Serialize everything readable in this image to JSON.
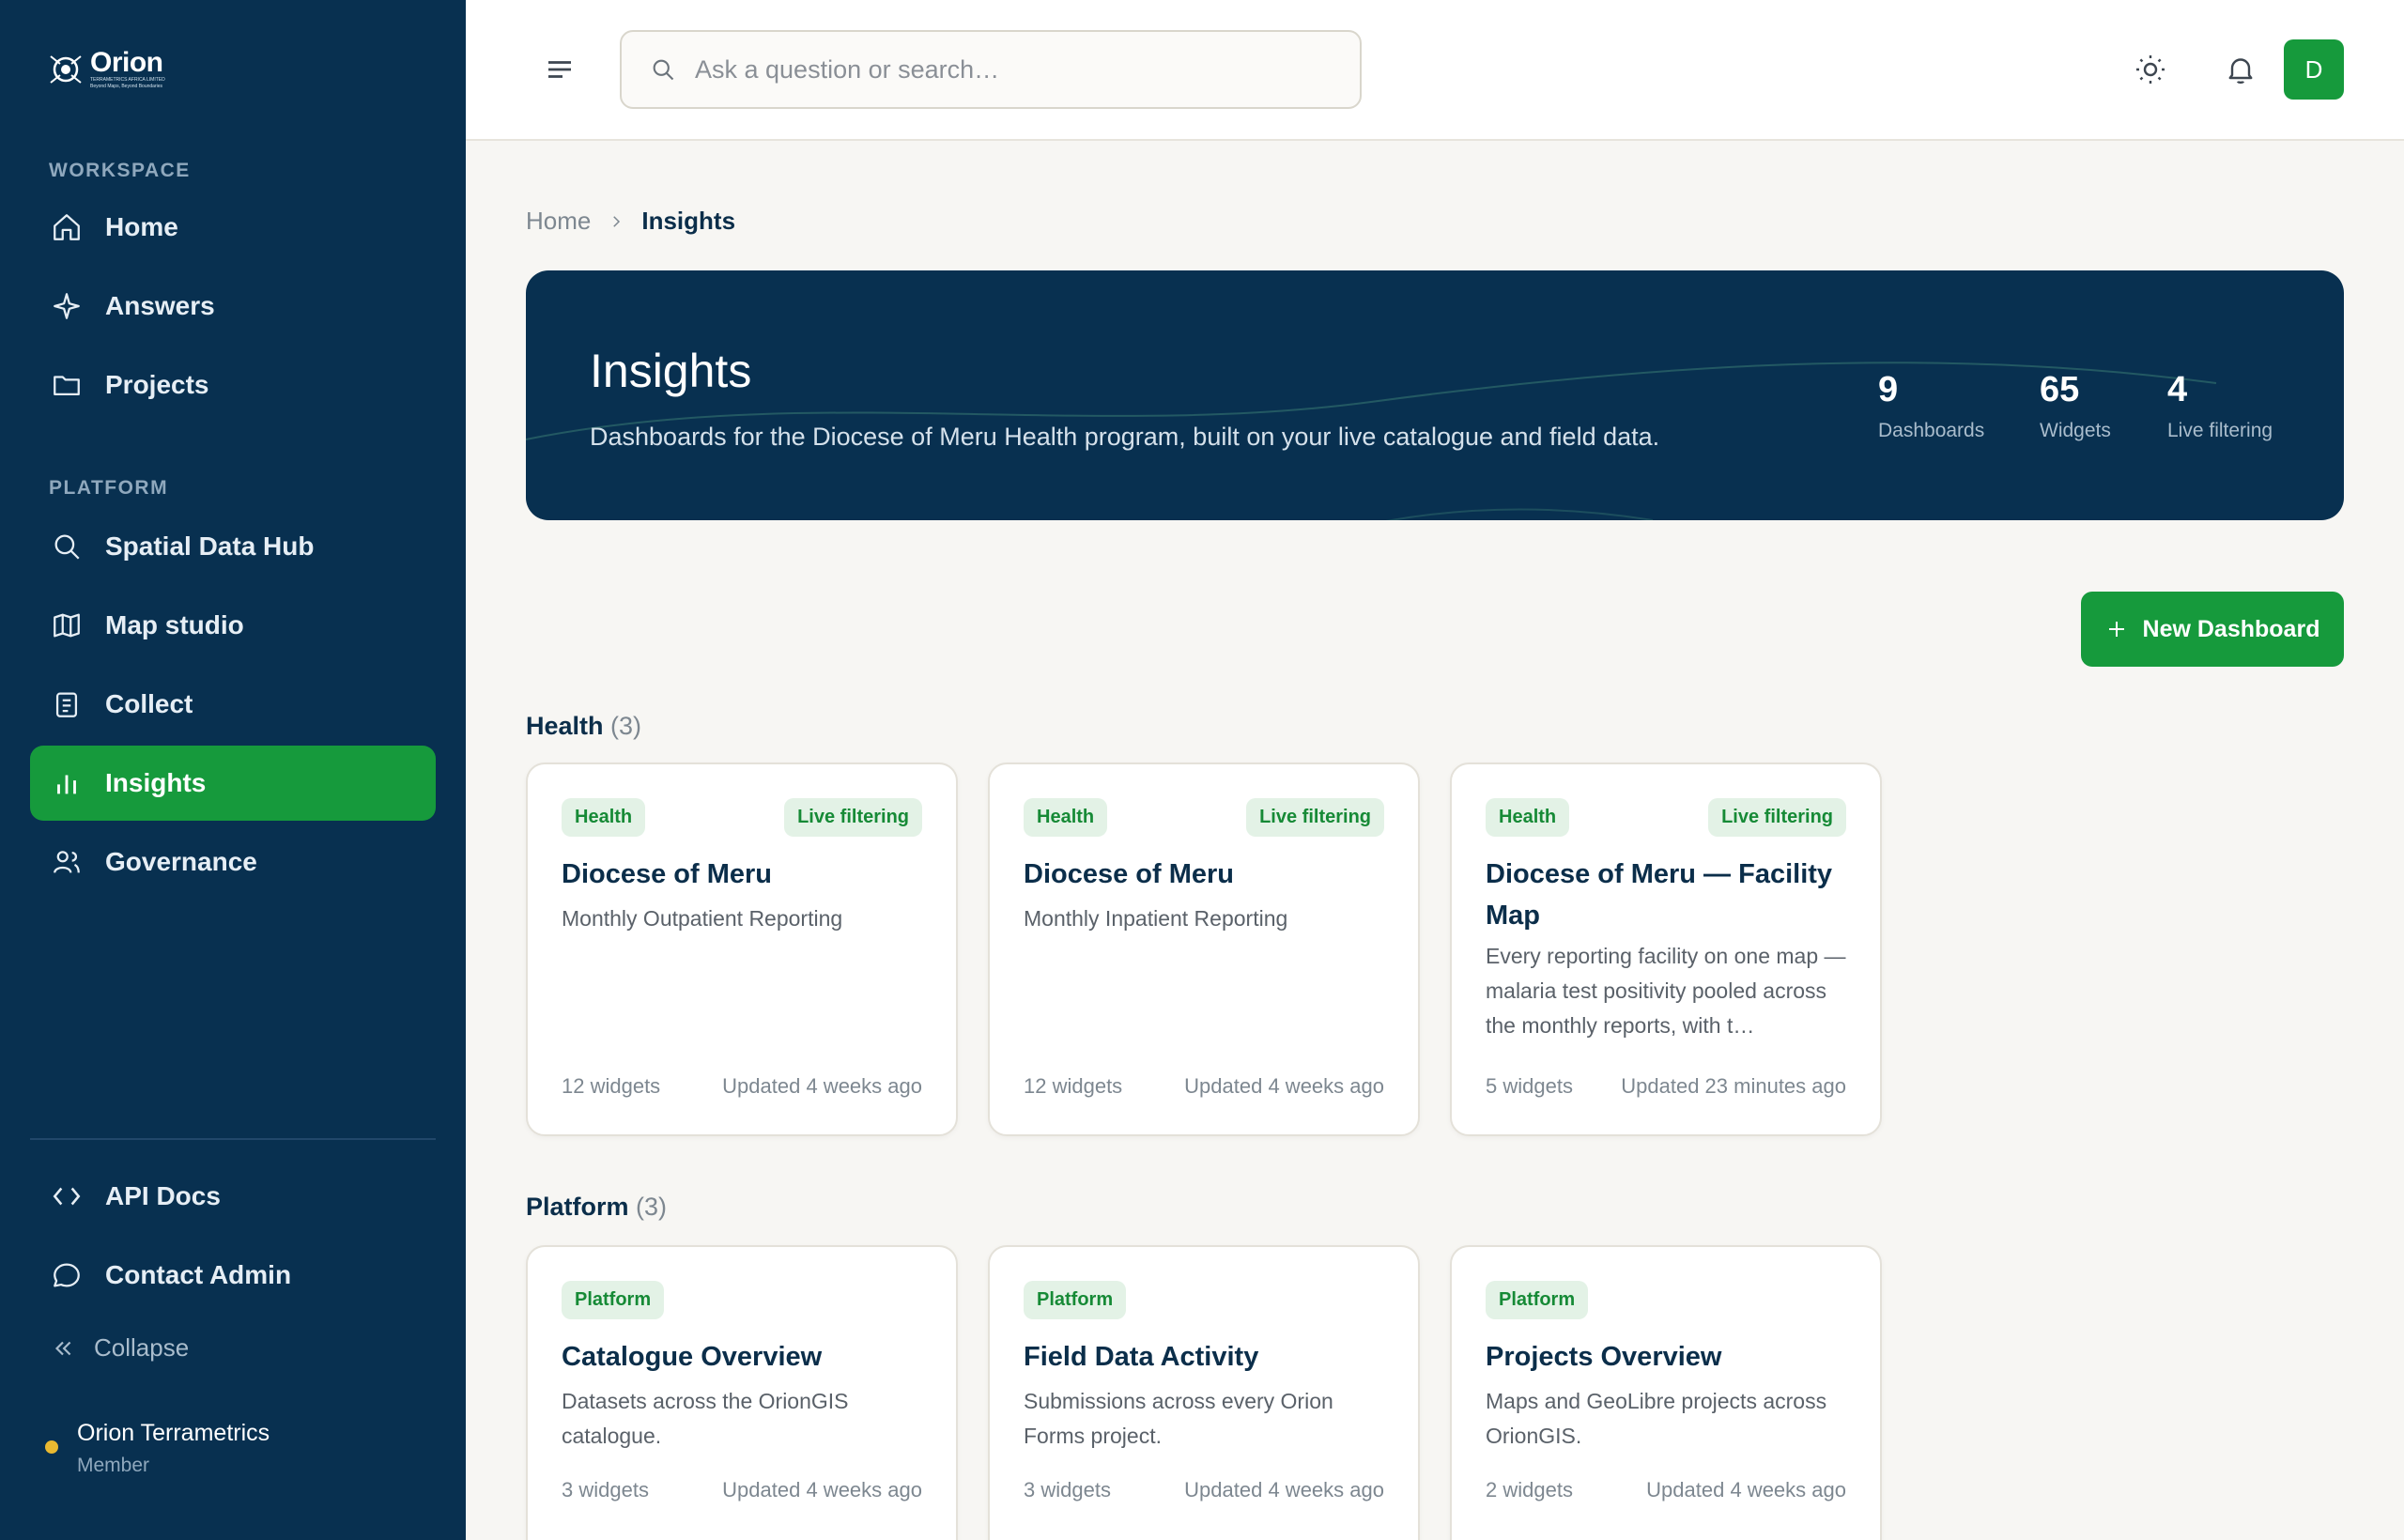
{
  "brand": {
    "name": "Orion",
    "tagline_1": "TERRAMETRICS AFRICA LIMITED",
    "tagline_2": "Beyond Maps, Beyond Boundaries"
  },
  "sidebar": {
    "workspace_label": "WORKSPACE",
    "platform_label": "PLATFORM",
    "items": [
      {
        "label": "Home",
        "icon": "home-icon"
      },
      {
        "label": "Answers",
        "icon": "sparkle-icon"
      },
      {
        "label": "Projects",
        "icon": "folder-icon"
      },
      {
        "label": "Spatial Data Hub",
        "icon": "search-icon"
      },
      {
        "label": "Map studio",
        "icon": "map-icon"
      },
      {
        "label": "Collect",
        "icon": "clipboard-icon"
      },
      {
        "label": "Insights",
        "icon": "bar-chart-icon",
        "active": true
      },
      {
        "label": "Governance",
        "icon": "users-icon"
      },
      {
        "label": "API Docs",
        "icon": "code-icon"
      },
      {
        "label": "Contact Admin",
        "icon": "chat-icon"
      }
    ],
    "collapse_label": "Collapse",
    "user": {
      "name": "Orion Terrametrics",
      "role": "Member",
      "status_color": "#e9b931"
    }
  },
  "header": {
    "search_placeholder": "Ask a question or search…",
    "avatar_initial": "D"
  },
  "breadcrumb": {
    "home": "Home",
    "current": "Insights"
  },
  "hero": {
    "title": "Insights",
    "subtitle": "Dashboards for the Diocese of Meru Health program, built on your live catalogue and field data.",
    "stats": [
      {
        "value": "9",
        "label": "Dashboards"
      },
      {
        "value": "65",
        "label": "Widgets"
      },
      {
        "value": "4",
        "label": "Live filtering"
      }
    ]
  },
  "new_dashboard_label": "New Dashboard",
  "groups": [
    {
      "title": "Health",
      "count": "(3)",
      "cards": [
        {
          "tag": "Health",
          "live": "Live filtering",
          "title": "Diocese of Meru",
          "desc": "Monthly Outpatient Reporting",
          "widgets": "12 widgets",
          "updated": "Updated 4 weeks ago"
        },
        {
          "tag": "Health",
          "live": "Live filtering",
          "title": "Diocese of Meru",
          "desc": "Monthly Inpatient Reporting",
          "widgets": "12 widgets",
          "updated": "Updated 4 weeks ago"
        },
        {
          "tag": "Health",
          "live": "Live filtering",
          "title": "Diocese of Meru — Facility Map",
          "desc": "Every reporting facility on one map — malaria test positivity pooled across the monthly reports, with t…",
          "widgets": "5 widgets",
          "updated": "Updated 23 minutes ago"
        }
      ]
    },
    {
      "title": "Platform",
      "count": "(3)",
      "cards": [
        {
          "tag": "Platform",
          "title": "Catalogue Overview",
          "desc": "Datasets across the OrionGIS catalogue.",
          "widgets": "3 widgets",
          "updated": "Updated 4 weeks ago"
        },
        {
          "tag": "Platform",
          "title": "Field Data Activity",
          "desc": "Submissions across every Orion Forms project.",
          "widgets": "3 widgets",
          "updated": "Updated 4 weeks ago"
        },
        {
          "tag": "Platform",
          "title": "Projects Overview",
          "desc": "Maps and GeoLibre projects across OrionGIS.",
          "widgets": "2 widgets",
          "updated": "Updated 4 weeks ago"
        }
      ]
    }
  ],
  "colors": {
    "sidebar_bg": "#083050",
    "accent_green": "#169a3c",
    "badge_bg": "#e3f2e6",
    "page_bg": "#f7f6f3"
  }
}
